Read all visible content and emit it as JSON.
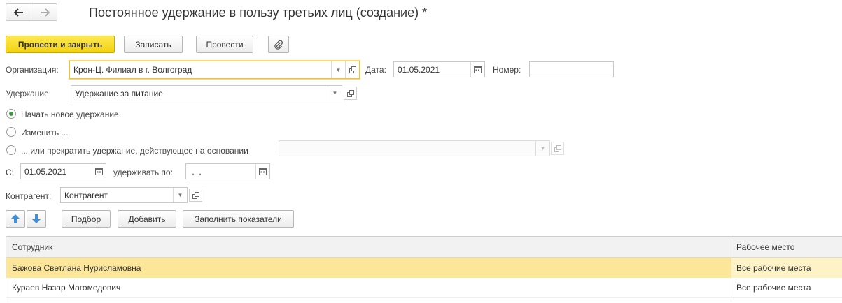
{
  "nav": {
    "back_icon": "arrow-left-icon",
    "forward_icon": "arrow-right-icon"
  },
  "title": "Постоянное удержание в пользу третьих лиц (создание) *",
  "toolbar": {
    "post_close": "Провести и закрыть",
    "save": "Записать",
    "post": "Провести",
    "attach_icon": "paperclip-icon"
  },
  "form": {
    "org_label": "Организация:",
    "org_value": "Крон-Ц. Филиал в г. Волгоград",
    "date_label": "Дата:",
    "date_value": "01.05.2021",
    "number_label": "Номер:",
    "number_value": "",
    "deduction_label": "Удержание:",
    "deduction_value": "Удержание за питание",
    "radio_new": "Начать новое удержание",
    "radio_change": "Изменить ...",
    "radio_stop": "... или прекратить удержание, действующее на основании",
    "basis_value": "",
    "from_label": "С:",
    "from_value": "01.05.2021",
    "hold_until_label": "удерживать по:",
    "hold_until_value": " .  .",
    "contractor_label": "Контрагент:",
    "contractor_value": "Контрагент"
  },
  "table_toolbar": {
    "up_icon": "arrow-up-icon",
    "down_icon": "arrow-down-icon",
    "pick": "Подбор",
    "add": "Добавить",
    "fill": "Заполнить показатели"
  },
  "table": {
    "columns": [
      "Сотрудник",
      "Рабочее место"
    ],
    "rows": [
      {
        "employee": "Бажова Светлана Нурисламовна",
        "workplace": "Все рабочие места",
        "selected": true
      },
      {
        "employee": "Кураев Назар Магомедович",
        "workplace": "Все рабочие места",
        "selected": false
      }
    ]
  },
  "colors": {
    "primary": "#f2d210",
    "selection": "#fbe69a",
    "radio_on": "#3d9b46",
    "arrow_blue": "#3f8fd8"
  }
}
